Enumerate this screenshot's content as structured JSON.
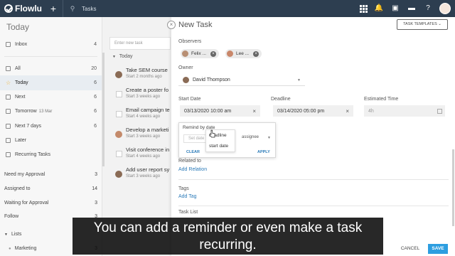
{
  "topbar": {
    "brand": "Flowlu",
    "section": "Tasks"
  },
  "sidebar": {
    "title": "Today",
    "items": [
      {
        "label": "Inbox",
        "count": "4"
      },
      {
        "label": "All",
        "count": "20"
      },
      {
        "label": "Today",
        "count": "6"
      },
      {
        "label": "Next",
        "count": "6"
      },
      {
        "label": "Tomorrow",
        "sub": "13 Mar",
        "count": "6"
      },
      {
        "label": "Next 7 days",
        "count": "6"
      },
      {
        "label": "Later",
        "count": ""
      },
      {
        "label": "Recurring Tasks",
        "count": ""
      }
    ],
    "groups": [
      {
        "label": "Need my Approval",
        "count": "3"
      },
      {
        "label": "Assigned to",
        "count": "14"
      },
      {
        "label": "Waiting for Approval",
        "count": "3"
      },
      {
        "label": "Follow",
        "count": "3"
      },
      {
        "label": "Lists",
        "count": ""
      },
      {
        "label": "Marketing",
        "count": "3"
      }
    ]
  },
  "tasklist": {
    "new_placeholder": "Enter new task",
    "group": "Today",
    "tasks": [
      {
        "title": "Take SEM course",
        "meta": "Start 2 months ago"
      },
      {
        "title": "Create a poster fo",
        "meta": "Start 3 weeks ago"
      },
      {
        "title": "Email campaign te",
        "meta": "Start 4 weeks ago"
      },
      {
        "title": "Develop a marketi",
        "meta": "Start 3 weeks ago"
      },
      {
        "title": "Visit conference in",
        "meta": "Start 4 weeks ago"
      },
      {
        "title": "Add user report sy",
        "meta": "Start 3 weeks ago"
      }
    ]
  },
  "panel": {
    "title": "New Task",
    "templates_button": "TASK TEMPLATES ⌄",
    "observers_label": "Observers",
    "observers": [
      "Felix ...",
      "Lee ..."
    ],
    "owner_label": "Owner",
    "owner": "David Thompson",
    "start_label": "Start Date",
    "start_value": "03/13/2020 10:00 am",
    "deadline_label": "Deadline",
    "deadline_value": "03/14/2020 05:00 pm",
    "estimate_label": "Estimated Time",
    "estimate_placeholder": "4h",
    "remind": {
      "title": "Remind by date",
      "set_placeholder": "Set date",
      "assignee": "assignee",
      "clear": "CLEAR",
      "apply": "APPLY",
      "options": [
        "deadline",
        "start date"
      ]
    },
    "related_label": "Related to",
    "related_link": "Add Relation",
    "tags_label": "Tags",
    "tags_link": "Add Tag",
    "tasklist_label": "Task List",
    "cancel": "CANCEL",
    "save": "SAVE"
  },
  "caption": {
    "line1": "You can add a reminder or even make a task",
    "line2": "recurring."
  },
  "colors": {
    "topbar": "#2d3e50",
    "accent": "#2d9ee0",
    "link": "#2a7ab8"
  }
}
